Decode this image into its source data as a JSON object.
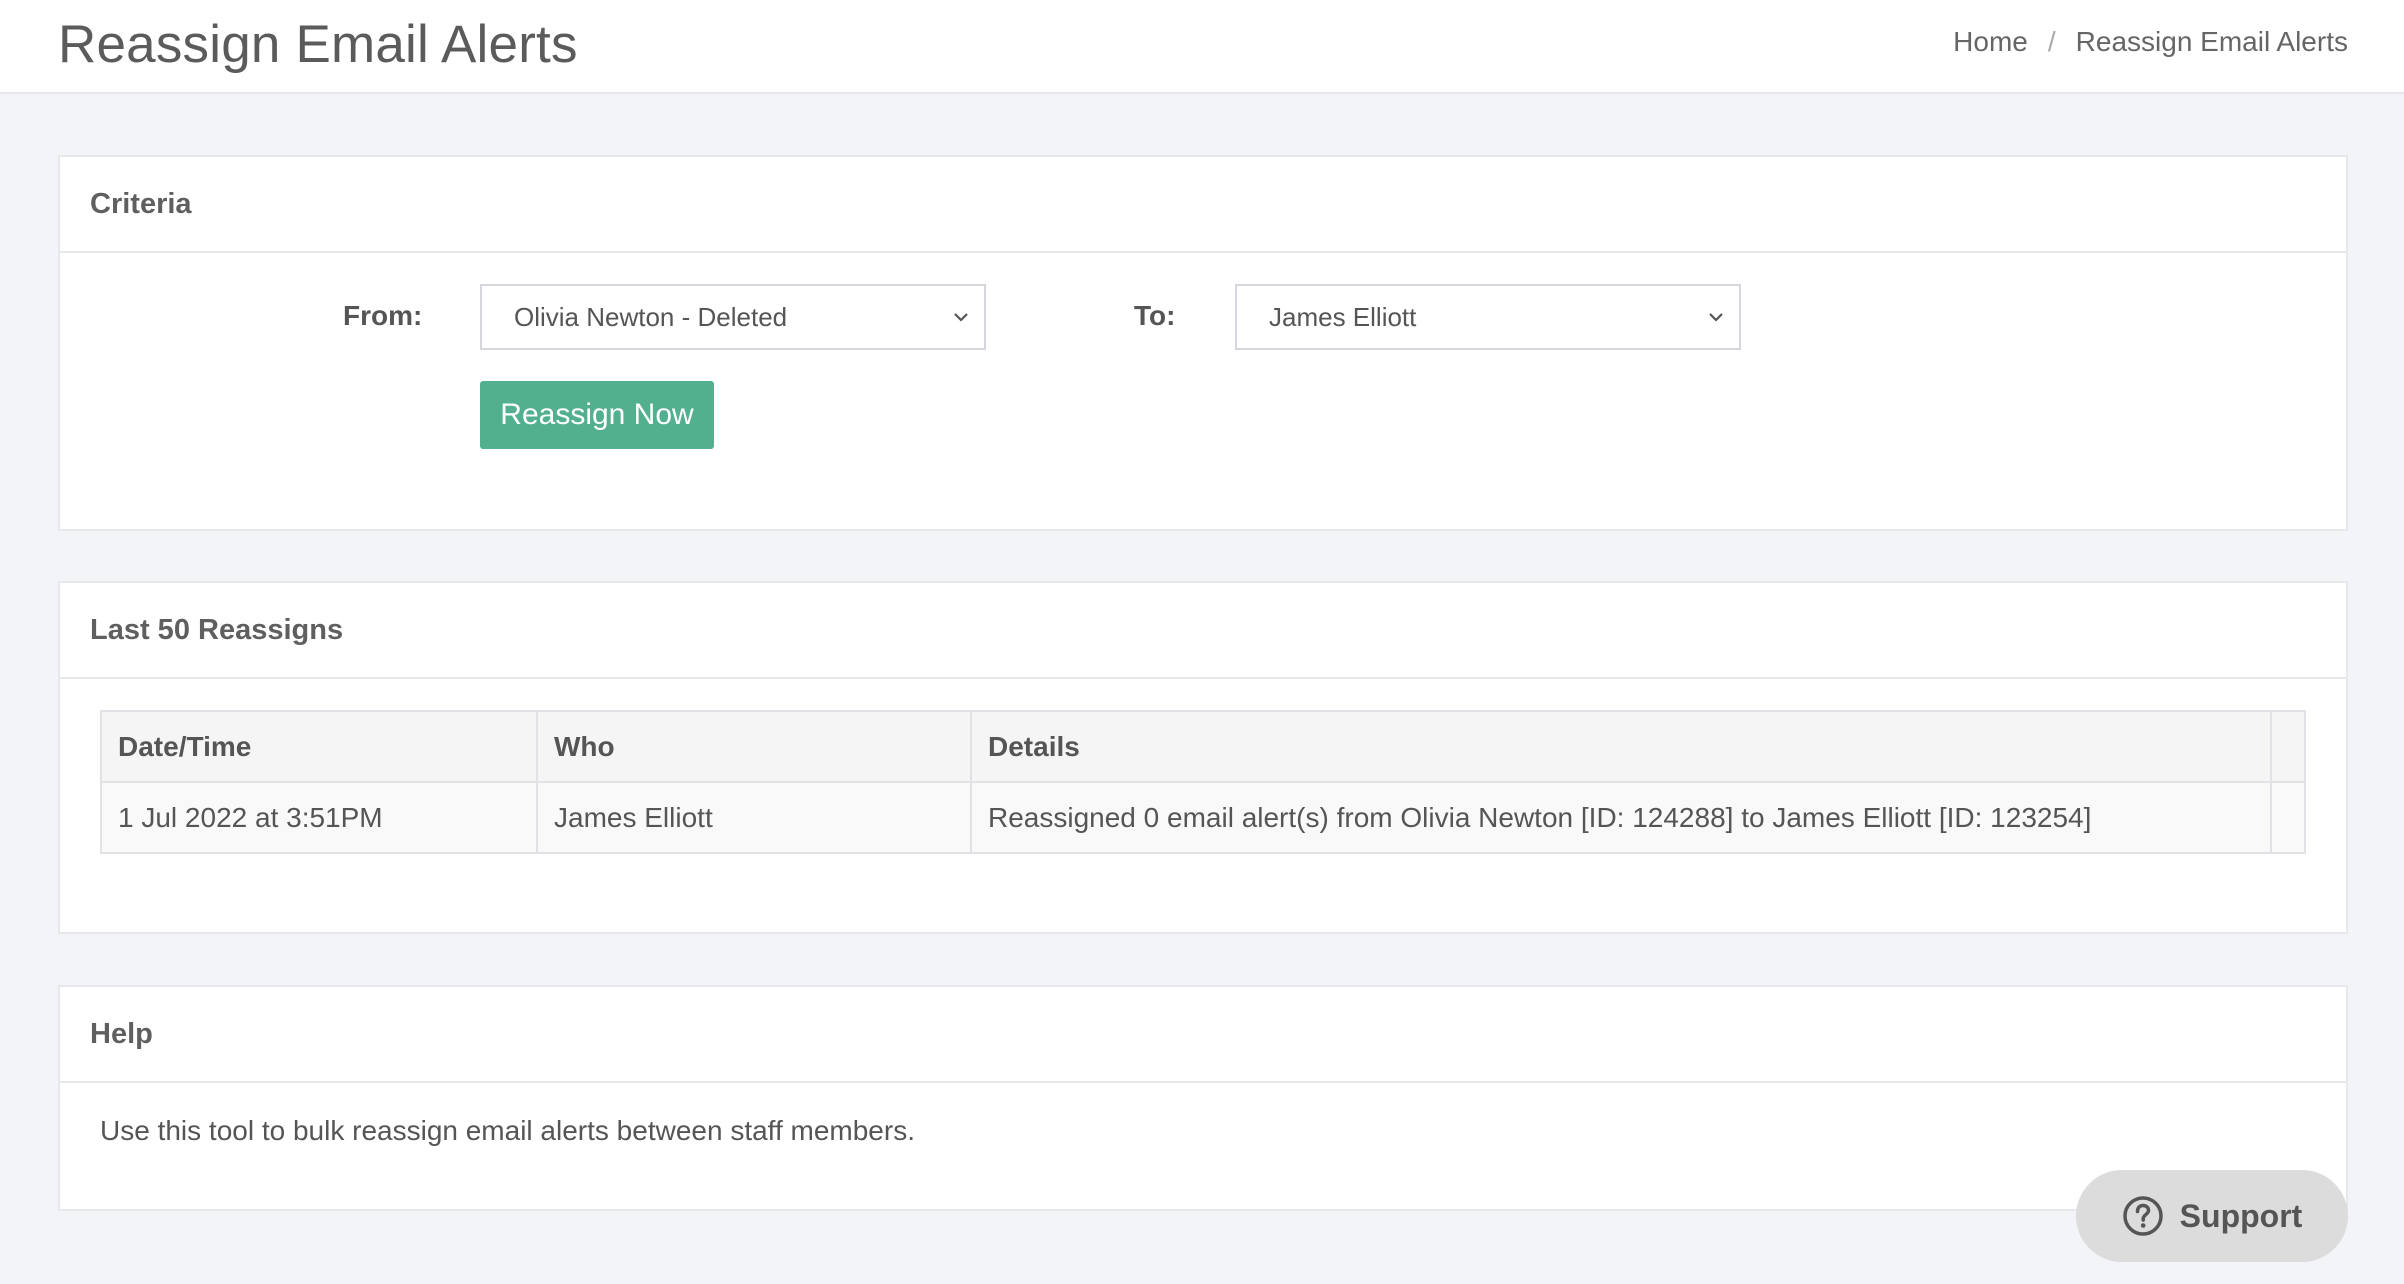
{
  "header": {
    "title": "Reassign Email Alerts",
    "breadcrumb": {
      "home": "Home",
      "separator": "/",
      "current": "Reassign Email Alerts"
    }
  },
  "criteria": {
    "title": "Criteria",
    "from_label": "From:",
    "from_value": "Olivia Newton - Deleted",
    "to_label": "To:",
    "to_value": "James Elliott",
    "submit_label": "Reassign Now"
  },
  "reassigns": {
    "title": "Last 50 Reassigns",
    "columns": [
      "Date/Time",
      "Who",
      "Details"
    ],
    "rows": [
      {
        "datetime": "1 Jul 2022 at 3:51PM",
        "who": "James Elliott",
        "details": "Reassigned 0 email alert(s) from Olivia Newton [ID: 124288] to James Elliott [ID: 123254]"
      }
    ]
  },
  "help": {
    "title": "Help",
    "text": "Use this tool to bulk reassign email alerts between staff members."
  },
  "support": {
    "label": "Support"
  },
  "colors": {
    "primary_button": "#52b08f",
    "background": "#f3f4f8",
    "support_bg": "#dcdcdc"
  },
  "icons": {
    "select_arrow": "chevron-down-icon",
    "support": "question-circle-icon"
  }
}
